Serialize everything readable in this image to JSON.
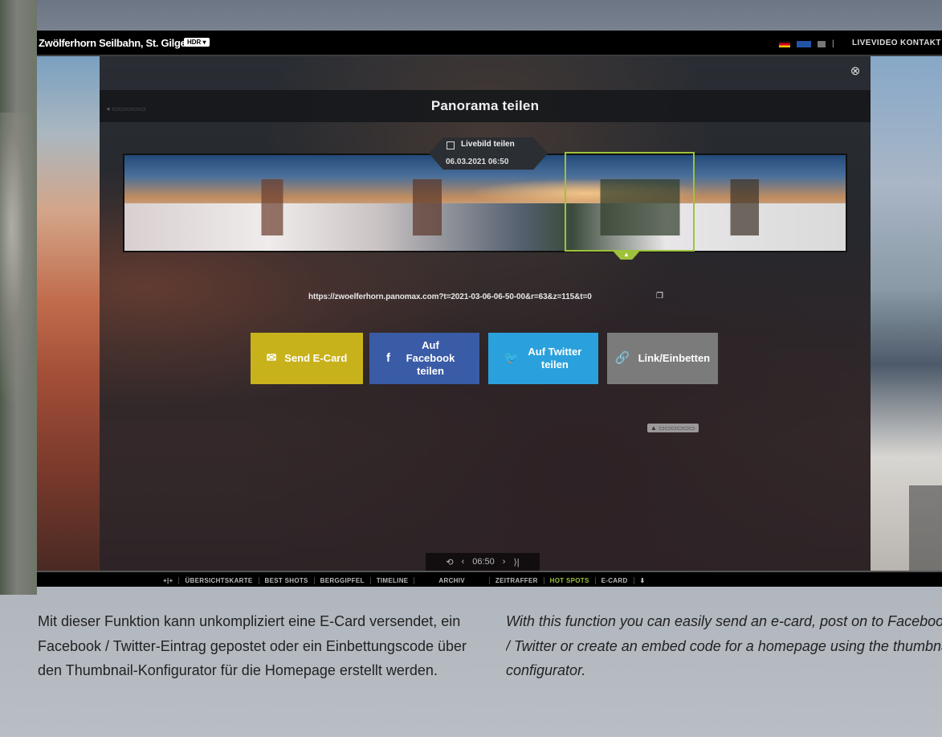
{
  "window": {
    "title": "Zwölferhorn Seilbahn, St. Gilgen",
    "hdr_badge": "HDR ▾"
  },
  "topnav": {
    "separator": "|",
    "livevideo": "LIVEVIDEO",
    "kontakt": "KONTAKT"
  },
  "share_panel": {
    "close_icon": "⊗",
    "title": "Panorama teilen",
    "live_checkbox_label": "Livebild teilen",
    "date": "06.03.2021 06:50",
    "arrow": "▲",
    "url": "https://zwoelferhorn.panomax.com?t=2021-03-06-06-50-00&r=63&z=115&t=0",
    "copy_icon": "❐",
    "buttons": [
      {
        "icon": "✉",
        "label": "Send E-Card",
        "color": "#c8b21b"
      },
      {
        "icon": "f",
        "label": "Auf Facebook teilen",
        "color": "#3a5ba6"
      },
      {
        "icon": "🐦",
        "label": "Auf Twitter teilen",
        "color": "#2aa1dc"
      },
      {
        "icon": "🔗",
        "label": "Link/Einbetten",
        "color": "#7b7b7b"
      }
    ]
  },
  "timebar": {
    "time": "06:50"
  },
  "menubar": {
    "items": [
      "+|+",
      "ÜBERSICHTSKARTE",
      "BEST SHOTS",
      "BERGGIPFEL",
      "TIMELINE",
      "ARCHIV",
      "ZEITRAFFER",
      "HOT SPOTS",
      "E-CARD",
      "⬇"
    ]
  },
  "description": {
    "de": "Mit dieser Funktion kann unkompliziert eine E-Card versendet, ein Facebook / Twitter-Eintrag gepostet oder ein Einbettungscode über den Thumbnail-Konfigurator für die Homepage erstellt werden.",
    "en": "With this function you can easily send an e-card, post on to Facebook / Twitter or create an embed code for a homepage using the thumbnail configurator."
  },
  "colors": {
    "accent_green": "#9ec23a",
    "ecard_yellow": "#c8b21b",
    "facebook_blue": "#3a5ba6",
    "twitter_blue": "#2aa1dc"
  }
}
